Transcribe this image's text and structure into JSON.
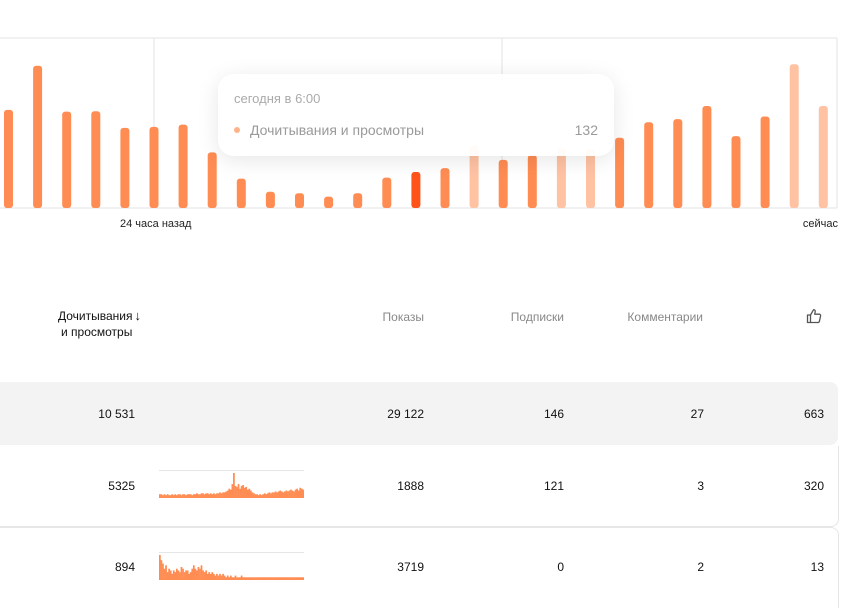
{
  "chart_data": {
    "type": "bar",
    "title": "",
    "xlabel": "",
    "ylabel": "",
    "x_tick_labels": [
      "24 часа назад",
      "сейчас"
    ],
    "grid": true,
    "legend": "none",
    "series": [
      {
        "name": "Дочитывания и просмотры",
        "values": [
          300,
          435,
          295,
          296,
          245,
          248,
          255,
          170,
          90,
          50,
          45,
          35,
          45,
          93,
          110,
          122,
          190,
          147,
          162,
          182,
          180,
          215,
          262,
          272,
          312,
          220,
          280,
          440,
          312
        ],
        "highlight_index": 14,
        "faded_indices": [
          16,
          19,
          20,
          27,
          28
        ]
      }
    ],
    "ylim": [
      0,
      520
    ],
    "colors": {
      "bar": "#ff8c52",
      "bar_highlight": "#ff5319",
      "bar_faded": "#ffc2a3"
    }
  },
  "tooltip": {
    "time": "сегодня в 6:00",
    "series_name": "Дочитывания и просмотры",
    "value": "132"
  },
  "axis": {
    "start_label": "24 часа назад",
    "end_label": "сейчас"
  },
  "table": {
    "headers": {
      "reads_line1": "Дочитывания",
      "reads_line2": "и просмотры",
      "sort_arrow": "↓",
      "shows": "Показы",
      "subscriptions": "Подписки",
      "comments": "Комментарии",
      "likes_icon": "thumbs-up-icon"
    },
    "total": {
      "reads": "10 531",
      "shows": "29 122",
      "subscriptions": "146",
      "comments": "27",
      "likes": "663"
    },
    "rows": [
      {
        "reads": "5325",
        "shows": "1888",
        "subscriptions": "121",
        "comments": "3",
        "likes": "320",
        "sparkline": [
          3,
          3,
          2,
          3,
          2,
          3,
          2,
          2,
          3,
          2,
          3,
          2,
          3,
          3,
          2,
          3,
          3,
          2,
          3,
          3,
          3,
          2,
          3,
          3,
          4,
          3,
          3,
          4,
          4,
          3,
          4,
          4,
          3,
          4,
          3,
          4,
          3,
          4,
          4,
          5,
          4,
          5,
          5,
          6,
          7,
          9,
          8,
          14,
          26,
          12,
          11,
          14,
          9,
          12,
          13,
          10,
          11,
          8,
          9,
          7,
          5,
          4,
          3,
          3,
          2,
          3,
          2,
          3,
          4,
          3,
          4,
          5,
          4,
          5,
          5,
          6,
          5,
          6,
          7,
          6,
          5,
          6,
          7,
          6,
          7,
          8,
          7,
          6,
          8,
          9,
          7,
          10,
          9,
          8
        ]
      },
      {
        "reads": "894",
        "shows": "3719",
        "subscriptions": "0",
        "comments": "2",
        "likes": "13",
        "sparkline": [
          14,
          11,
          9,
          6,
          8,
          4,
          6,
          5,
          3,
          5,
          4,
          6,
          5,
          4,
          7,
          6,
          4,
          5,
          5,
          3,
          4,
          6,
          8,
          6,
          5,
          7,
          6,
          8,
          5,
          4,
          5,
          3,
          4,
          3,
          4,
          3,
          2,
          3,
          2,
          3,
          2,
          3,
          2,
          1,
          2,
          1,
          2,
          1,
          1,
          2,
          1,
          1,
          1,
          2,
          1,
          1,
          1,
          1,
          1,
          1,
          1,
          1,
          1,
          1,
          1,
          1,
          1,
          1,
          1,
          1,
          1,
          1,
          1,
          1,
          1,
          1,
          1,
          1,
          1,
          1,
          1,
          1,
          1,
          1,
          1,
          1,
          1,
          1,
          1,
          1,
          1,
          1,
          1,
          1
        ]
      }
    ]
  }
}
